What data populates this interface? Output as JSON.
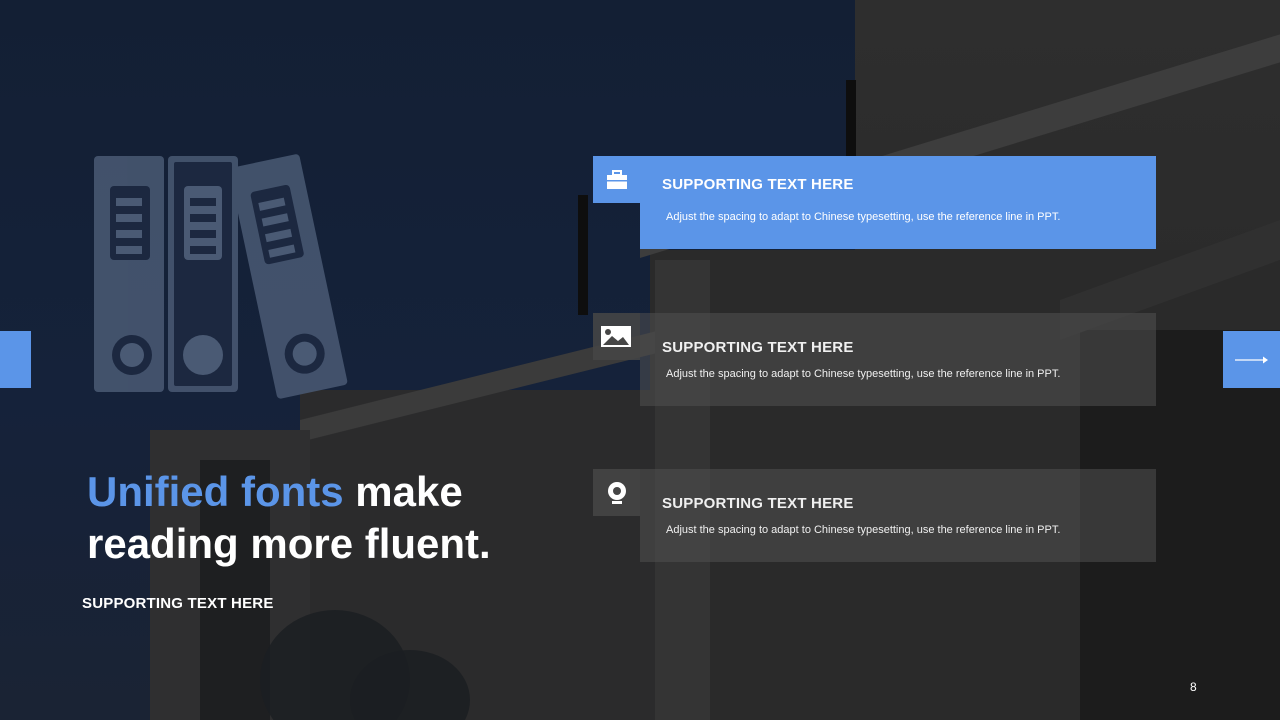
{
  "slide": {
    "heading_accent": "Unified fonts",
    "heading_rest_line1": " make",
    "heading_line2": "reading more fluent.",
    "supporting_text": "SUPPORTING TEXT HERE",
    "page_number": "8"
  },
  "nav": {
    "next_icon": "arrow-right-icon",
    "accent_color": "#5b95e8"
  },
  "cards": [
    {
      "icon": "briefcase-icon",
      "title": "SUPPORTING TEXT HERE",
      "description": "Adjust the spacing to adapt to Chinese typesetting, use the reference line in PPT.",
      "state": "active"
    },
    {
      "icon": "image-icon",
      "title": "SUPPORTING TEXT HERE",
      "description": "Adjust the spacing to adapt to Chinese typesetting, use the reference line in PPT.",
      "state": "muted"
    },
    {
      "icon": "webcam-icon",
      "title": "SUPPORTING TEXT HERE",
      "description": "Adjust the spacing to adapt to Chinese typesetting, use the reference line in PPT.",
      "state": "muted"
    }
  ],
  "decor": {
    "binder_icon": "binders-icon"
  }
}
